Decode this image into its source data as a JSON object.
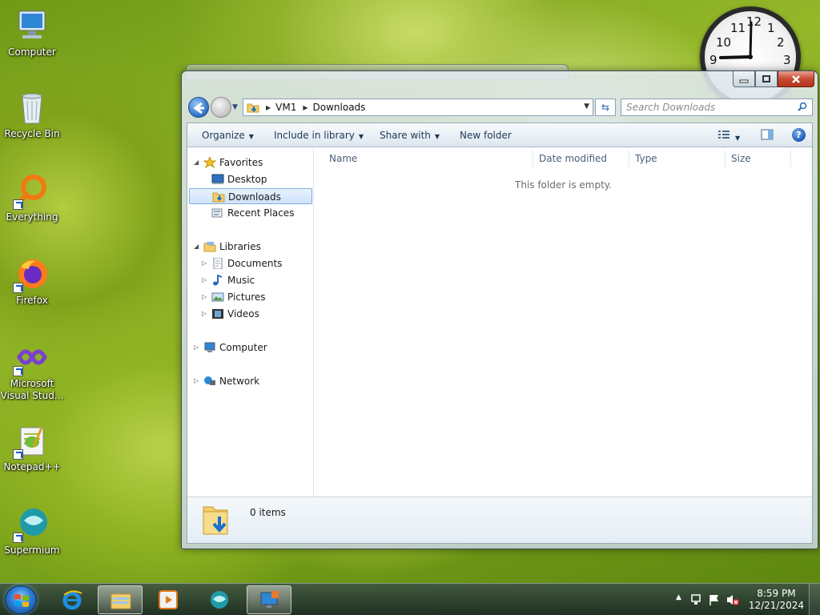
{
  "desktop": {
    "icons": [
      {
        "label": "Computer"
      },
      {
        "label": "Recycle Bin"
      },
      {
        "label": "Everything"
      },
      {
        "label": "Firefox"
      },
      {
        "label": "Microsoft Visual Stud..."
      },
      {
        "label": "Notepad++"
      },
      {
        "label": "Supermium"
      }
    ]
  },
  "clock_gadget": {
    "numbers": [
      "11",
      "12",
      "1",
      "10",
      "2",
      "9",
      "3"
    ]
  },
  "explorer": {
    "address": {
      "root": "VM1",
      "current": "Downloads"
    },
    "search": {
      "placeholder": "Search Downloads"
    },
    "toolbar": {
      "organize": "Organize",
      "include_in_library": "Include in library",
      "share_with": "Share with",
      "new_folder": "New folder"
    },
    "nav": {
      "favorites": "Favorites",
      "desktop": "Desktop",
      "downloads": "Downloads",
      "recent_places": "Recent Places",
      "libraries": "Libraries",
      "documents": "Documents",
      "music": "Music",
      "pictures": "Pictures",
      "videos": "Videos",
      "computer": "Computer",
      "network": "Network"
    },
    "columns": {
      "name": "Name",
      "date_modified": "Date modified",
      "type": "Type",
      "size": "Size"
    },
    "empty_message": "This folder is empty.",
    "details": {
      "item_count": "0 items"
    }
  },
  "taskbar": {
    "time": "8:59 PM",
    "date": "12/21/2024"
  },
  "colors": {
    "accent": "#2b6fc5",
    "close_button": "#c84a33"
  }
}
